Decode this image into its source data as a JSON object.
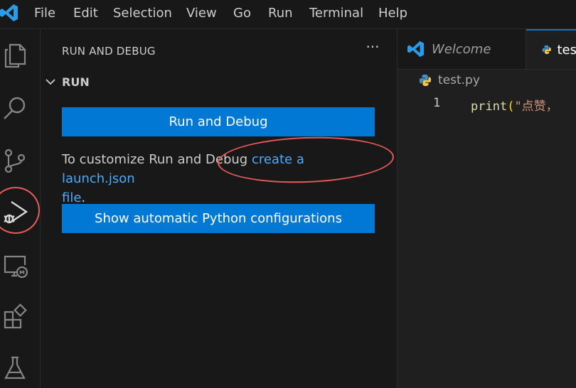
{
  "menubar": {
    "items": [
      "File",
      "Edit",
      "Selection",
      "View",
      "Go",
      "Run",
      "Terminal",
      "Help"
    ]
  },
  "activity_bar": {
    "icons": [
      "explorer-icon",
      "search-icon",
      "source-control-icon",
      "run-and-debug-icon",
      "remote-explorer-icon",
      "extensions-icon",
      "testing-icon"
    ],
    "active": "run-and-debug-icon"
  },
  "sidebar": {
    "title": "RUN AND DEBUG",
    "more_label": "···",
    "section_label": "RUN",
    "run_debug_button": "Run and Debug",
    "description_prefix": "To customize Run and Debug ",
    "link_text_1": "create a launch.json",
    "link_text_2": "file",
    "description_suffix": ".",
    "python_config_button": "Show automatic Python configurations"
  },
  "editor": {
    "tabs": [
      {
        "label": "Welcome",
        "icon": "vscode-icon"
      },
      {
        "label": "tes",
        "icon": "python-icon"
      }
    ],
    "breadcrumb": "test.py",
    "lines": [
      {
        "number": "1",
        "fn": "print",
        "open": "(",
        "string": "\"点赞，"
      }
    ]
  },
  "colors": {
    "accent": "#0078d4",
    "link": "#4daafc",
    "annotation_circle": "#e85a5a",
    "background": "#181818"
  }
}
